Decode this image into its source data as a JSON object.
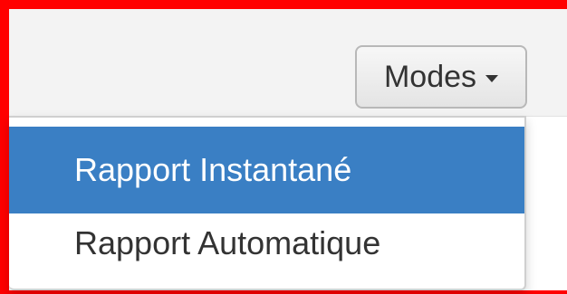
{
  "toolbar": {
    "modes_button": {
      "label": "Modes",
      "icon": "chevron-down-icon"
    }
  },
  "dropdown": {
    "items": [
      {
        "label": "Rapport Instantané",
        "active": true
      },
      {
        "label": "Rapport Automatique",
        "active": false
      }
    ]
  },
  "colors": {
    "highlight_border": "#ff0000",
    "active_item_bg": "#3a7fc4",
    "active_item_text": "#ffffff",
    "text": "#333333",
    "toolbar_bg": "#f3f3f3"
  }
}
